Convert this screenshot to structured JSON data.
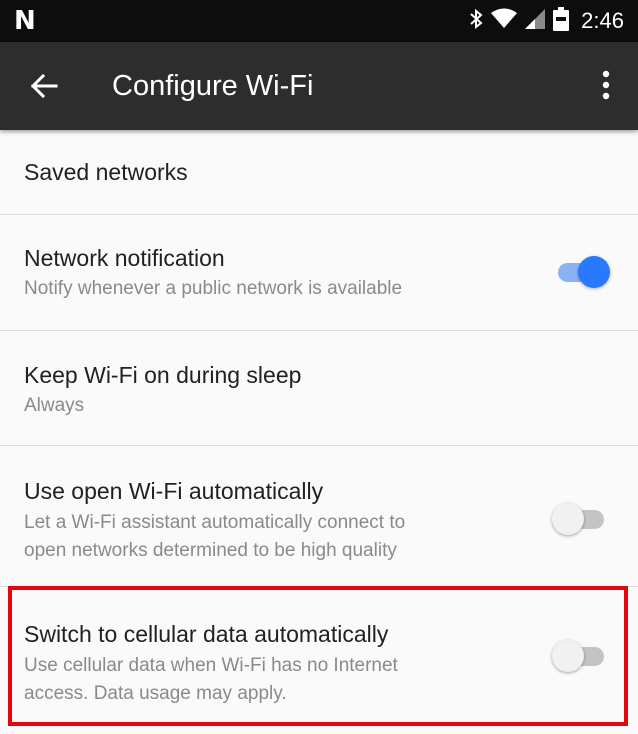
{
  "status_bar": {
    "brand": "N",
    "time": "2:46",
    "icons": [
      "bluetooth-icon",
      "wifi-icon",
      "cell-signal-icon",
      "battery-icon"
    ]
  },
  "app_bar": {
    "title": "Configure Wi-Fi",
    "back_icon": "arrow-back-icon",
    "menu_icon": "more-vert-icon",
    "background": "#2d2d2d"
  },
  "settings": {
    "saved_networks": {
      "title": "Saved networks"
    },
    "network_notification": {
      "title": "Network notification",
      "summary": "Notify whenever a public network is available",
      "enabled": true
    },
    "keep_wifi_on": {
      "title": "Keep Wi-Fi on during sleep",
      "summary": "Always"
    },
    "use_open_wifi": {
      "title": "Use open Wi-Fi automatically",
      "summary_line1": "Let a Wi-Fi assistant automatically connect to",
      "summary_line2": "open networks determined to be high quality",
      "enabled": false
    },
    "switch_to_cellular": {
      "title": "Switch to cellular data automatically",
      "summary_line1": "Use cellular data when Wi-Fi has no Internet",
      "summary_line2": "access. Data usage may apply.",
      "enabled": false
    }
  },
  "colors": {
    "accent": "#2979ff",
    "highlight": "#e3070d",
    "background": "#fafafa"
  }
}
